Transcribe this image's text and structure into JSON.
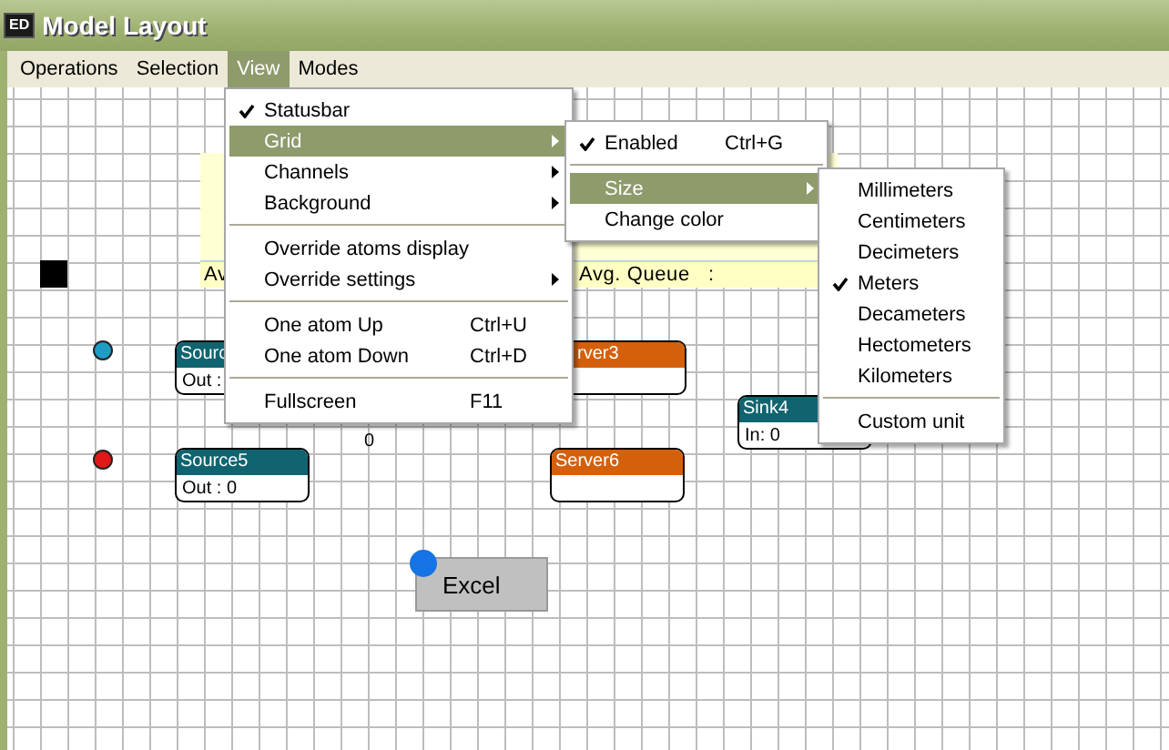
{
  "window": {
    "icon_text": "ED",
    "title": "Model Layout"
  },
  "menubar": [
    {
      "label": "Operations",
      "selected": false
    },
    {
      "label": "Selection",
      "selected": false
    },
    {
      "label": "View",
      "selected": true
    },
    {
      "label": "Modes",
      "selected": false
    }
  ],
  "canvas": {
    "stats_panel": {
      "labels": [
        "Av",
        "Avg. Queue   :"
      ]
    },
    "dots": [
      {
        "color": "#1e9cc4"
      },
      {
        "color": "#e01818"
      }
    ],
    "nodes": [
      {
        "kind": "source",
        "title": "Sourc",
        "value": "Out :"
      },
      {
        "kind": "server",
        "title": "rver3"
      },
      {
        "kind": "sink",
        "title": "Sink4",
        "value": "In: 0"
      },
      {
        "kind": "source",
        "title": "Source5",
        "value": "Out : 0"
      },
      {
        "kind": "server",
        "title": "Server6"
      }
    ],
    "value_labels": [
      "0"
    ],
    "excel_block": {
      "label": "Excel"
    }
  },
  "menus": [
    {
      "items": [
        {
          "kind": "item",
          "label": "Statusbar",
          "checked": true,
          "selected": false,
          "submenu": false
        },
        {
          "kind": "item",
          "label": "Grid",
          "checked": false,
          "selected": true,
          "submenu": true
        },
        {
          "kind": "item",
          "label": "Channels",
          "checked": false,
          "selected": false,
          "submenu": true
        },
        {
          "kind": "item",
          "label": "Background",
          "checked": false,
          "selected": false,
          "submenu": true
        },
        {
          "kind": "separator"
        },
        {
          "kind": "item",
          "label": "Override atoms display",
          "checked": false,
          "selected": false,
          "submenu": false
        },
        {
          "kind": "item",
          "label": "Override settings",
          "checked": false,
          "selected": false,
          "submenu": true
        },
        {
          "kind": "separator"
        },
        {
          "kind": "item",
          "label": "One atom Up",
          "shortcut": "Ctrl+U",
          "checked": false,
          "selected": false,
          "submenu": false
        },
        {
          "kind": "item",
          "label": "One atom Down",
          "shortcut": "Ctrl+D",
          "checked": false,
          "selected": false,
          "submenu": false
        },
        {
          "kind": "separator"
        },
        {
          "kind": "item",
          "label": "Fullscreen",
          "shortcut": "F11",
          "checked": false,
          "selected": false,
          "submenu": false
        }
      ]
    },
    {
      "items": [
        {
          "kind": "item",
          "label": "Enabled",
          "shortcut": "Ctrl+G",
          "checked": true,
          "selected": false,
          "submenu": false
        },
        {
          "kind": "separator"
        },
        {
          "kind": "item",
          "label": "Size",
          "checked": false,
          "selected": true,
          "submenu": true
        },
        {
          "kind": "item",
          "label": "Change color",
          "checked": false,
          "selected": false,
          "submenu": false
        }
      ]
    },
    {
      "items": [
        {
          "kind": "item",
          "label": "Millimeters",
          "checked": false,
          "selected": false,
          "submenu": false
        },
        {
          "kind": "item",
          "label": "Centimeters",
          "checked": false,
          "selected": false,
          "submenu": false
        },
        {
          "kind": "item",
          "label": "Decimeters",
          "checked": false,
          "selected": false,
          "submenu": false
        },
        {
          "kind": "item",
          "label": "Meters",
          "checked": true,
          "selected": false,
          "submenu": false
        },
        {
          "kind": "item",
          "label": "Decameters",
          "checked": false,
          "selected": false,
          "submenu": false
        },
        {
          "kind": "item",
          "label": "Hectometers",
          "checked": false,
          "selected": false,
          "submenu": false
        },
        {
          "kind": "item",
          "label": "Kilometers",
          "checked": false,
          "selected": false,
          "submenu": false
        },
        {
          "kind": "separator"
        },
        {
          "kind": "item",
          "label": "Custom unit",
          "checked": false,
          "selected": false,
          "submenu": false
        }
      ]
    }
  ]
}
